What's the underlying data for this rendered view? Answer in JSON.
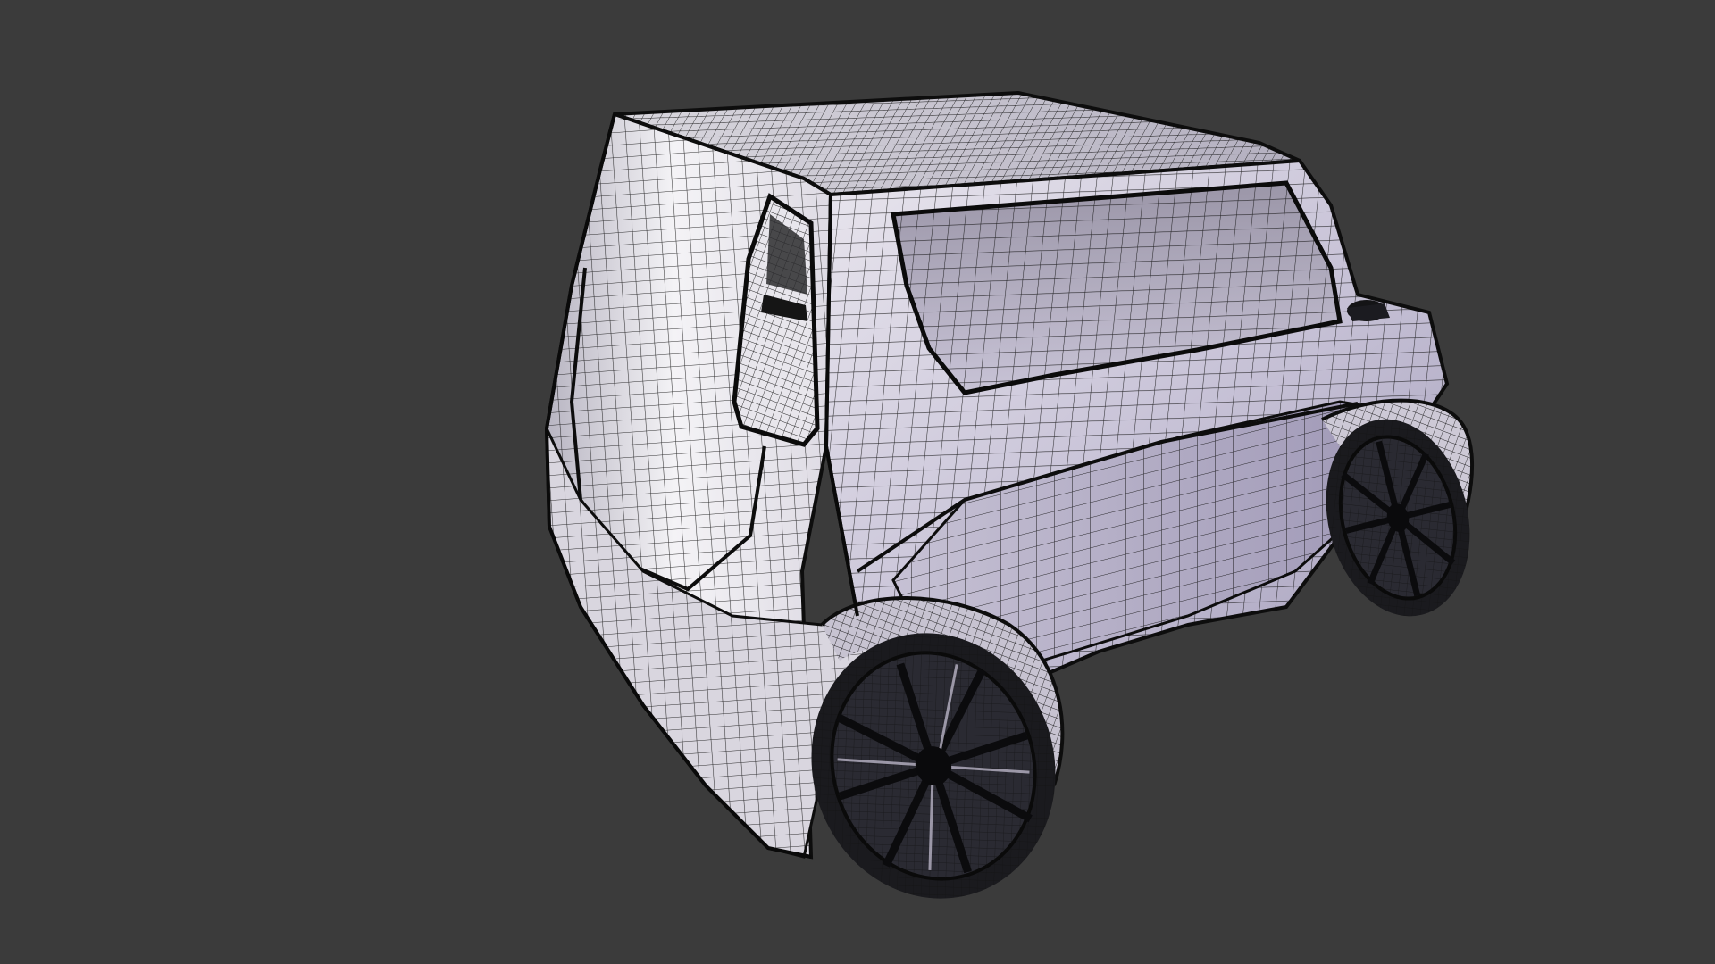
{
  "viewport": {
    "background": "#3b3b3b",
    "display_mode": "wireframe-on-shaded",
    "subject": "car-model"
  },
  "model": {
    "body_color_light": "#f2f0f4",
    "body_color_mid": "#c9c4d6",
    "body_color_dark": "#8e88a3",
    "wire_color": "#111111",
    "tire_color": "#1a1a1e",
    "rim_color": "#2a2a32"
  }
}
